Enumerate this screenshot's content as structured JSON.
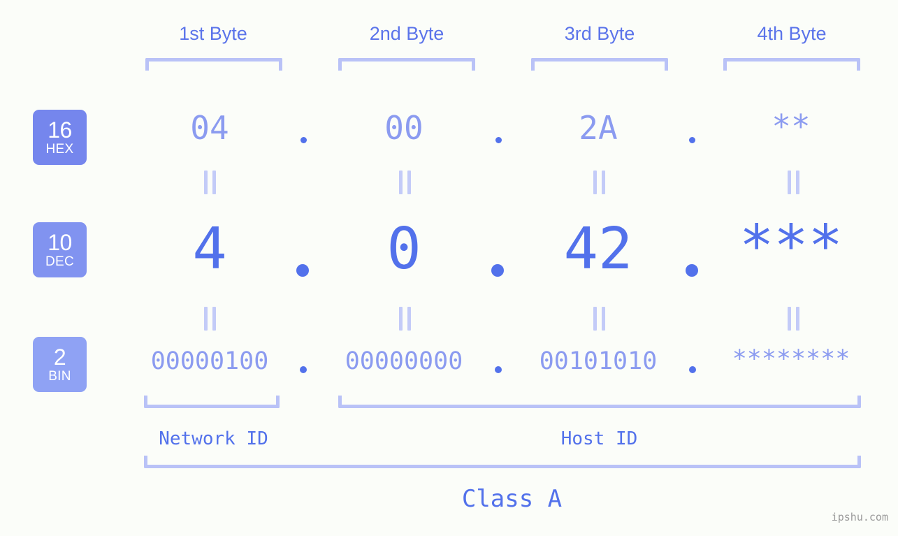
{
  "background_color": "#fbfdf9",
  "accent_color": "#5271eb",
  "accent_light_color": "#8b9bf0",
  "bracket_color": "#b9c2f7",
  "header": {
    "byte_labels": [
      {
        "text": "1st Byte"
      },
      {
        "text": "2nd Byte"
      },
      {
        "text": "3rd Byte"
      },
      {
        "text": "4th Byte"
      }
    ]
  },
  "badges": [
    {
      "number": "16",
      "name": "HEX",
      "color": "#7586ed"
    },
    {
      "number": "10",
      "name": "DEC",
      "color": "#8193f0"
    },
    {
      "number": "2",
      "name": "BIN",
      "color": "#8fa2f4"
    }
  ],
  "rows": {
    "hex": {
      "base": "16",
      "base_name": "HEX",
      "values": [
        "04",
        "00",
        "2A",
        "**"
      ],
      "separator": "."
    },
    "dec": {
      "base": "10",
      "base_name": "DEC",
      "values": [
        "4",
        "0",
        "42",
        "***"
      ],
      "separator": "."
    },
    "bin": {
      "base": "2",
      "base_name": "BIN",
      "values": [
        "00000100",
        "00000000",
        "00101010",
        "********"
      ],
      "separator": "."
    }
  },
  "equals_separator": "‖",
  "footer": {
    "network_id_label": "Network ID",
    "host_id_label": "Host ID",
    "class_label": "Class A"
  },
  "watermark": "ipshu.com"
}
